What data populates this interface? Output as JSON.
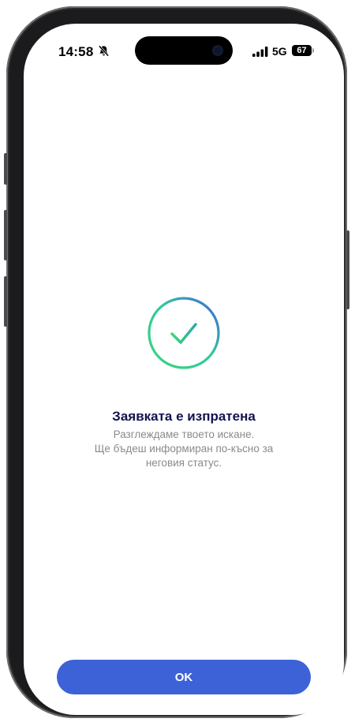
{
  "status_bar": {
    "time": "14:58",
    "silent_icon": "bell-slash-icon",
    "network": "5G",
    "battery": "67"
  },
  "confirmation": {
    "icon": "check-circle-icon",
    "title": "Заявката е изпратена",
    "message_line1": "Разглеждаме твоето искане.",
    "message_line2": "Ще бъдеш информиран по-късно за",
    "message_line3": "неговия статус."
  },
  "actions": {
    "ok_label": "OK"
  },
  "colors": {
    "accent": "#3d62d8",
    "title": "#14134f",
    "gradient_start": "#37d67a",
    "gradient_end": "#3d62d8"
  }
}
